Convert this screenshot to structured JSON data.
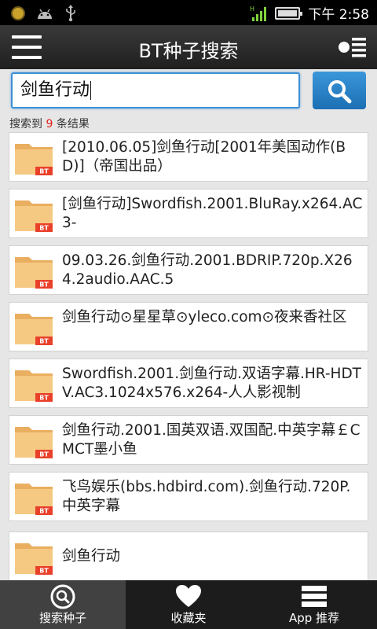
{
  "status_bar": {
    "time": "下午 2:58",
    "signal_label": "H"
  },
  "header": {
    "title": "BT种子搜索"
  },
  "search": {
    "query": "剑鱼行动"
  },
  "results_summary": {
    "prefix": "搜索到 ",
    "count": "9",
    "suffix": " 条结果"
  },
  "file_badge": "BT",
  "results": [
    "[2010.06.05]剑鱼行动[2001年美国动作(BD)]（帝国出品）",
    "[剑鱼行动]Swordfish.2001.BluRay.x264.AC3-",
    "09.03.26.剑鱼行动.2001.BDRIP.720p.X264.2audio.AAC.5",
    "剑鱼行动⊙星星草⊙yleco.com⊙夜来香社区",
    "Swordfish.2001.剑鱼行动.双语字幕.HR-HDTV.AC3.1024x576.x264-人人影视制",
    "剑鱼行动.2001.国英双语.双国配.中英字幕￡CMCT墨小鱼",
    "飞鸟娱乐(bbs.hdbird.com).剑鱼行动.720P.中英字幕",
    "剑鱼行动"
  ],
  "bottom_nav": [
    {
      "label": "搜索种子",
      "active": true
    },
    {
      "label": "收藏夹",
      "active": false
    },
    {
      "label": "App 推荐",
      "active": false
    }
  ],
  "colors": {
    "accent": "#2a84c8",
    "count_highlight": "#e0211b",
    "folder": "#f5c27a",
    "badge": "#e8402a"
  }
}
